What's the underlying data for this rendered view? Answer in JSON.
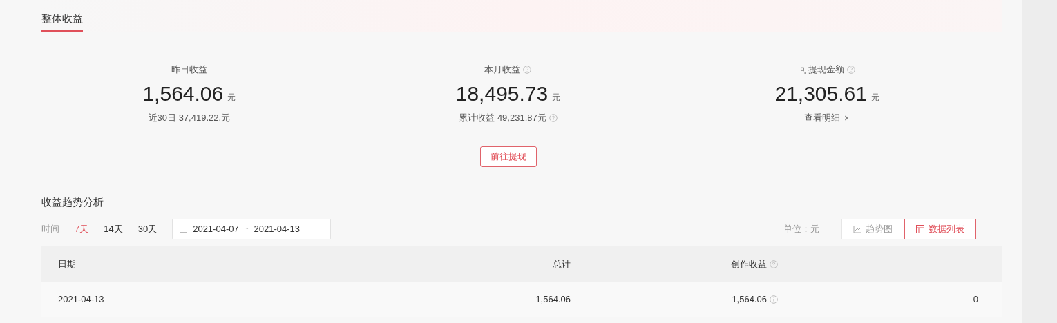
{
  "tabs": [
    {
      "label": "整体收益",
      "selected": true
    }
  ],
  "stats": [
    {
      "label": "昨日收益",
      "kind": "plain",
      "value": "1,564.06",
      "unit": "元",
      "sub": "近30日 37,419.22.元"
    },
    {
      "label": "本月收益",
      "kind": "help",
      "value": "18,495.73",
      "unit": "元",
      "sub": "累计收益 49,231.87元"
    },
    {
      "label": "可提现金额",
      "kind": "link",
      "value": "21,305.61",
      "unit": "元",
      "sub": "查看明细"
    }
  ],
  "withdraw_button": "前往提现",
  "trend": {
    "title": "收益趋势分析",
    "range_label": "时间",
    "ranges": [
      {
        "label": "7天",
        "selected": true
      },
      {
        "label": "14天",
        "selected": false
      },
      {
        "label": "30天",
        "selected": false
      }
    ],
    "date_start": "2021-04-07",
    "date_sep": "~",
    "date_end": "2021-04-13",
    "unit": "单位：元",
    "views": [
      {
        "label": "趋势图",
        "kind": "chart",
        "selected": false
      },
      {
        "label": "数据列表",
        "kind": "list",
        "selected": true
      }
    ]
  },
  "table": {
    "columns": [
      {
        "label": "日期",
        "kind": "text"
      },
      {
        "label": "总计",
        "kind": "text"
      },
      {
        "label": "创作收益",
        "kind": "help"
      },
      {
        "kind": "blank"
      }
    ],
    "rows": [
      {
        "cells": [
          {
            "text": "2021-04-13",
            "kind": "text"
          },
          {
            "text": "1,564.06",
            "kind": "text"
          },
          {
            "text": "1,564.06",
            "kind": "info"
          },
          {
            "text": "0",
            "kind": "text"
          }
        ]
      }
    ]
  }
}
